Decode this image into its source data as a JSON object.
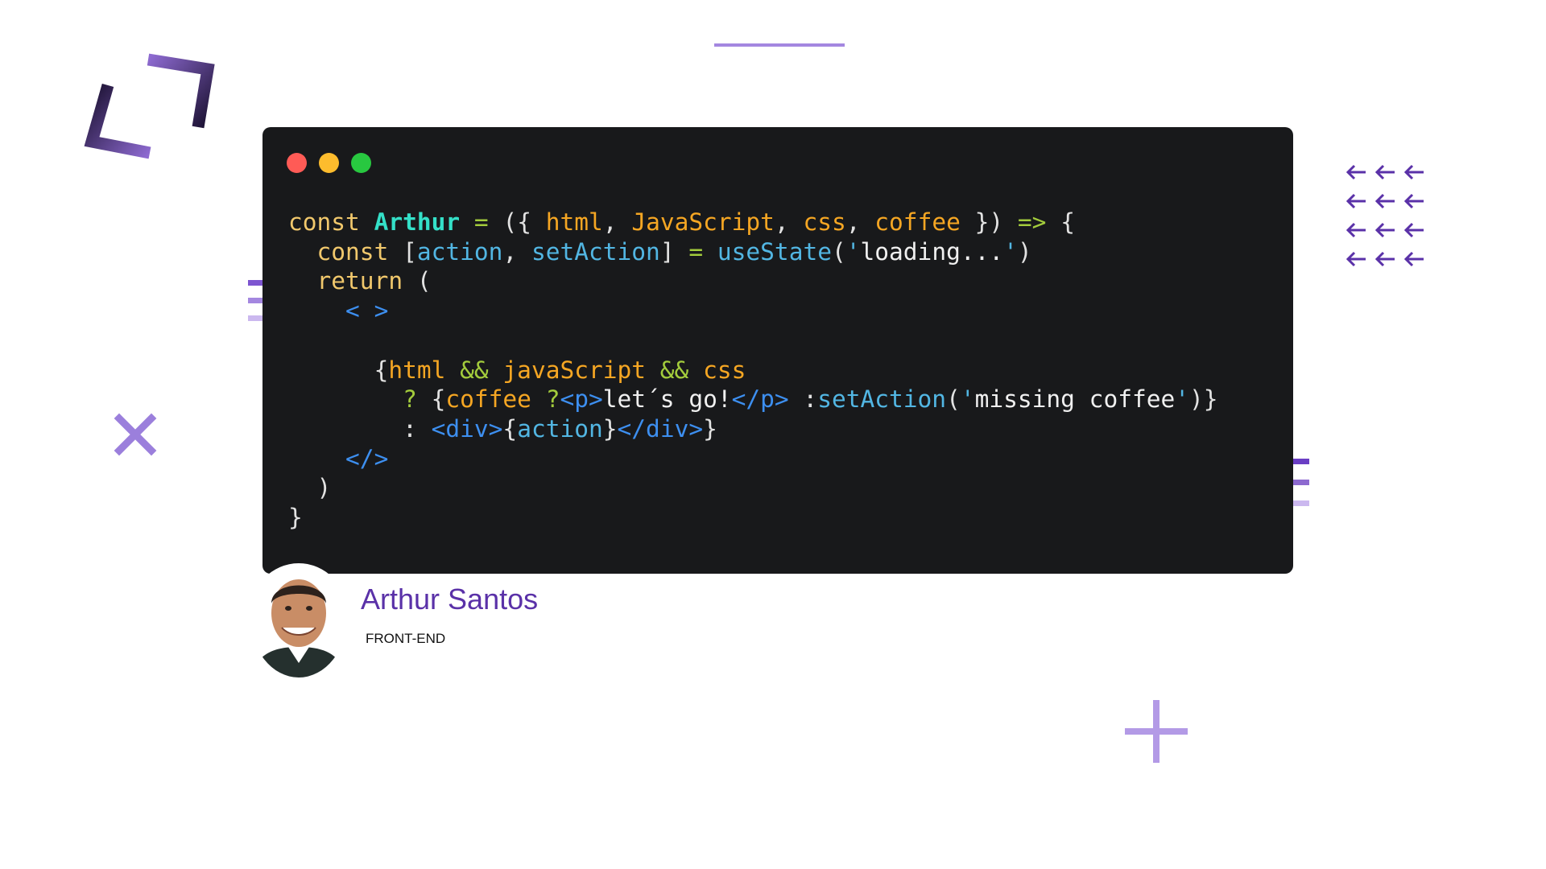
{
  "code_window": {
    "lines": [
      [
        {
          "t": "const ",
          "c": "kw"
        },
        {
          "t": "Arthur",
          "c": "fn-name"
        },
        {
          "t": " ",
          "c": "pl"
        },
        {
          "t": "=",
          "c": "op"
        },
        {
          "t": " ({ ",
          "c": "pl"
        },
        {
          "t": "html",
          "c": "param"
        },
        {
          "t": ", ",
          "c": "pl"
        },
        {
          "t": "JavaScript",
          "c": "param"
        },
        {
          "t": ", ",
          "c": "pl"
        },
        {
          "t": "css",
          "c": "param"
        },
        {
          "t": ", ",
          "c": "pl"
        },
        {
          "t": "coffee",
          "c": "param"
        },
        {
          "t": " }) ",
          "c": "pl"
        },
        {
          "t": "=>",
          "c": "op"
        },
        {
          "t": " {",
          "c": "pl"
        }
      ],
      [
        {
          "t": "  const ",
          "c": "kw"
        },
        {
          "t": "[",
          "c": "pl"
        },
        {
          "t": "action",
          "c": "var"
        },
        {
          "t": ", ",
          "c": "pl"
        },
        {
          "t": "setAction",
          "c": "var"
        },
        {
          "t": "] ",
          "c": "pl"
        },
        {
          "t": "=",
          "c": "op"
        },
        {
          "t": " ",
          "c": "pl"
        },
        {
          "t": "useState",
          "c": "var"
        },
        {
          "t": "(",
          "c": "pl"
        },
        {
          "t": "'",
          "c": "var"
        },
        {
          "t": "loading...",
          "c": "str"
        },
        {
          "t": "'",
          "c": "var"
        },
        {
          "t": ")",
          "c": "pl"
        }
      ],
      [
        {
          "t": "  return ",
          "c": "kw"
        },
        {
          "t": "(",
          "c": "pl"
        }
      ],
      [
        {
          "t": "    < >",
          "c": "tag"
        }
      ],
      [],
      [
        {
          "t": "      {",
          "c": "pl"
        },
        {
          "t": "html",
          "c": "param"
        },
        {
          "t": " && ",
          "c": "op"
        },
        {
          "t": "javaScript",
          "c": "param"
        },
        {
          "t": " && ",
          "c": "op"
        },
        {
          "t": "css",
          "c": "param"
        }
      ],
      [
        {
          "t": "        ? ",
          "c": "op"
        },
        {
          "t": "{",
          "c": "pl"
        },
        {
          "t": "coffee ",
          "c": "param"
        },
        {
          "t": "?",
          "c": "op"
        },
        {
          "t": "<p>",
          "c": "tag"
        },
        {
          "t": "let´s go!",
          "c": "str"
        },
        {
          "t": "</p>",
          "c": "tag"
        },
        {
          "t": " :",
          "c": "pl"
        },
        {
          "t": "setAction",
          "c": "var"
        },
        {
          "t": "(",
          "c": "pl"
        },
        {
          "t": "'",
          "c": "var"
        },
        {
          "t": "missing coffee",
          "c": "str"
        },
        {
          "t": "'",
          "c": "var"
        },
        {
          "t": ")}",
          "c": "pl"
        }
      ],
      [
        {
          "t": "        : ",
          "c": "pl"
        },
        {
          "t": "<div>",
          "c": "tag"
        },
        {
          "t": "{",
          "c": "pl"
        },
        {
          "t": "action",
          "c": "var"
        },
        {
          "t": "}",
          "c": "pl"
        },
        {
          "t": "</div>",
          "c": "tag"
        },
        {
          "t": "}",
          "c": "pl"
        }
      ],
      [
        {
          "t": "    </>",
          "c": "tag"
        }
      ],
      [
        {
          "t": "  )",
          "c": "pl"
        }
      ],
      [
        {
          "t": "}",
          "c": "pl"
        }
      ]
    ]
  },
  "profile": {
    "name": "Arthur Santos",
    "role": "FRONT-END"
  },
  "colors": {
    "accent": "#5a31a8",
    "accent_light": "#a487e0",
    "window_bg": "#18191b"
  },
  "icons": [
    "frame-bracket-icon",
    "arrow-left-icon",
    "x-icon",
    "plus-icon"
  ]
}
